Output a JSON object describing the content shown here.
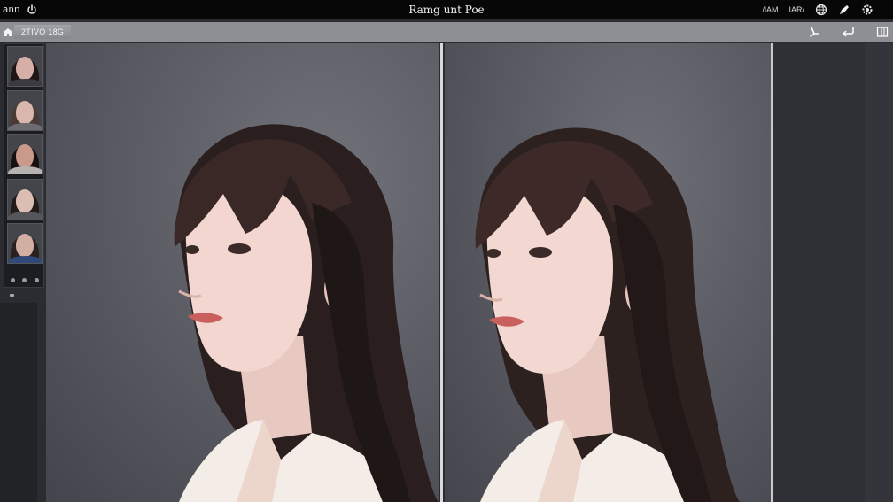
{
  "window": {
    "app_label": "ann",
    "title": "Ramg unt Poe",
    "status_labels": [
      "/lAM",
      "IAR/"
    ]
  },
  "toolbar": {
    "tab_label": "2TIVO 18G"
  },
  "filmstrip": {
    "thumbnail_count": 5
  },
  "colors": {
    "titlebar": "#070708",
    "toolbar": "#8e8f94",
    "canvas_bg": "#5c5d65",
    "hair": "#2a1f1e",
    "skin": "#f2d6cf",
    "shirt": "#f3ece7"
  },
  "icons": {
    "titlebar_left": "power-icon",
    "titlebar_right": [
      "globe-icon",
      "brush-icon",
      "settings-gear-icon"
    ],
    "toolbar_left": "home-icon",
    "toolbar_right": [
      "pen-tool-icon",
      "hook-arrow-icon",
      "panel-toggle-icon"
    ]
  }
}
